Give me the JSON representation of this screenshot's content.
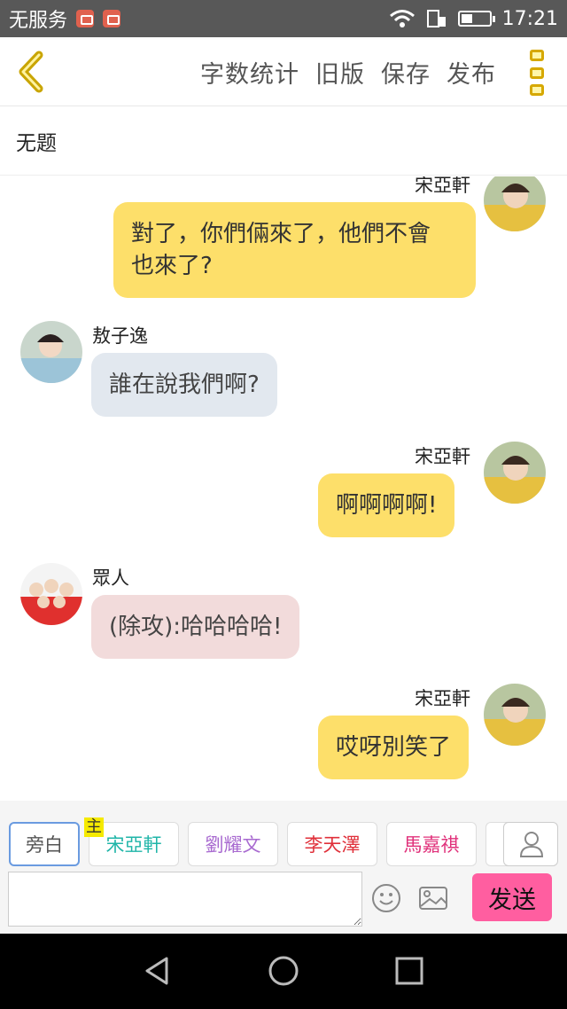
{
  "status_bar": {
    "carrier": "无服务",
    "time": "17:21",
    "icons": [
      "mail-notification-icon",
      "app-notification-icon",
      "wifi-icon",
      "signal-icon",
      "battery-icon"
    ]
  },
  "toolbar": {
    "actions": [
      "字数统计",
      "旧版",
      "保存",
      "发布"
    ]
  },
  "document": {
    "title": "无题"
  },
  "messages": [
    {
      "side": "right",
      "name": "宋亞軒",
      "text_lines": [
        "對了，你們倆來了，他們不會",
        "也來了?"
      ],
      "color": "#fddf6a"
    },
    {
      "side": "left",
      "name": "敖子逸",
      "text_lines": [
        "誰在說我們啊?"
      ],
      "color": "#e2e8ef"
    },
    {
      "side": "right",
      "name": "宋亞軒",
      "text_lines": [
        "啊啊啊啊!"
      ],
      "color": "#fddf6a"
    },
    {
      "side": "left",
      "name": "眾人",
      "text_lines": [
        "(除攻):哈哈哈哈!"
      ],
      "color": "#f2dbdb"
    },
    {
      "side": "right",
      "name": "宋亞軒",
      "text_lines": [
        "哎呀別笑了"
      ],
      "color": "#fddf6a"
    }
  ],
  "roles": [
    {
      "label": "旁白",
      "color": "#555555",
      "selected": true
    },
    {
      "label": "宋亞軒",
      "color": "#1fb5a8",
      "master_tag": "主"
    },
    {
      "label": "劉耀文",
      "color": "#a86ad0"
    },
    {
      "label": "李天澤",
      "color": "#e0303a"
    },
    {
      "label": "馬嘉祺",
      "color": "#e0307a"
    }
  ],
  "composer": {
    "placeholder": "",
    "send_label": "发送"
  },
  "colors": {
    "accent_yellow": "#fddf6a",
    "send_pink": "#ff5ea0",
    "toolbar_icon": "#d6a800"
  }
}
